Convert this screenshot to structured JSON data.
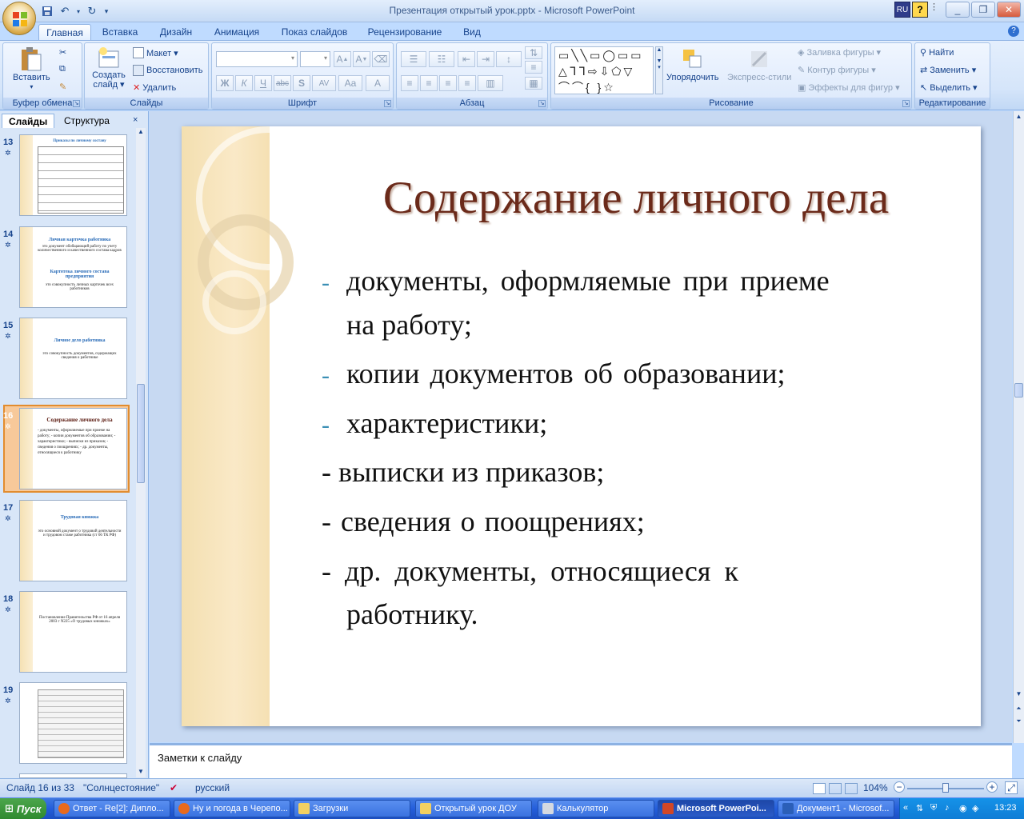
{
  "window": {
    "title": "Презентация открытый урок.pptx - Microsoft PowerPoint",
    "lang": "RU",
    "help": "?"
  },
  "tabs": [
    "Главная",
    "Вставка",
    "Дизайн",
    "Анимация",
    "Показ слайдов",
    "Рецензирование",
    "Вид"
  ],
  "ribbon": {
    "clipboard": {
      "label": "Буфер обмена",
      "paste": "Вставить"
    },
    "slides": {
      "label": "Слайды",
      "new_slide": "Создать слайд ▾",
      "layout": "Макет ▾",
      "reset": "Восстановить",
      "delete": "Удалить"
    },
    "font": {
      "label": "Шрифт",
      "buttons": [
        "Ж",
        "К",
        "Ч",
        "abc",
        "S",
        "AV",
        "Aa",
        "A"
      ]
    },
    "paragraph": {
      "label": "Абзац"
    },
    "drawing": {
      "label": "Рисование",
      "arrange": "Упорядочить",
      "quick_styles": "Экспресс-стили",
      "fill": "Заливка фигуры ▾",
      "outline": "Контур фигуры ▾",
      "effects": "Эффекты для фигур ▾"
    },
    "editing": {
      "label": "Редактирование",
      "find": "Найти",
      "replace": "Заменить ▾",
      "select": "Выделить ▾"
    }
  },
  "left_pane": {
    "tabs": [
      "Слайды",
      "Структура"
    ],
    "close": "×",
    "thumbnails": [
      {
        "num": "13",
        "title": "Приказы по личному составу",
        "body": ""
      },
      {
        "num": "14",
        "title": "Личная карточка работника",
        "body": "это документ обобщающий работу по учету количественного и качественного состава кадров",
        "title2": "Картотека личного состава предприятия",
        "body2": "это совокупность личных карточек всех работников"
      },
      {
        "num": "15",
        "title": "Личное дело работника",
        "body": "это совокупность документов, содержащих сведения о работнике"
      },
      {
        "num": "16",
        "title": "Содержание личного дела",
        "body": "- документы, оформляемые при приеме на работу; - копии документов об образовании; - характеристики; - выписки из приказов; - сведения о поощрениях; - др. документы, относящиеся к работнику"
      },
      {
        "num": "17",
        "title": "Трудовая книжка",
        "body": "это основной документ о трудовой деятельности и трудовом стаже работника (ст 66 ТК РФ)"
      },
      {
        "num": "18",
        "title": "",
        "body": "Постановление Правительства РФ от 16 апреля 2003 г N225 «О трудовых книжках»"
      },
      {
        "num": "19",
        "title": "",
        "body": ""
      }
    ]
  },
  "slide": {
    "title": "Содержание личного дела",
    "bullets": [
      {
        "marker": "-",
        "text": "документы, оформляемые при приеме",
        "cont": "на работу;"
      },
      {
        "marker": "-",
        "text": "копии документов об образовании;"
      },
      {
        "marker": "-",
        "text": "характеристики;"
      },
      {
        "marker": "-",
        "text": " выписки из приказов;"
      },
      {
        "marker": "-",
        "text": " сведения о поощрениях;"
      },
      {
        "marker": "-",
        "text": " др. документы, относящиеся к",
        "cont": "работнику."
      }
    ]
  },
  "notes": {
    "placeholder": "Заметки к слайду"
  },
  "status": {
    "slide": "Слайд 16 из 33",
    "theme": "\"Солнцестояние\"",
    "language": "русский",
    "zoom": "104%"
  },
  "taskbar": {
    "start": "Пуск",
    "tasks": [
      "Ответ - Re[2]: Дипло...",
      "Ну и погода в Черепо...",
      "Загрузки",
      "Открытый урок ДОУ",
      "Калькулятор",
      "Microsoft PowerPoi...",
      "Документ1 - Microsof..."
    ],
    "time": "13:23"
  },
  "colors": {
    "accent": "#15428b",
    "title": "#6b2a1a",
    "bullet_dash": "#3b8fb5",
    "selection": "#e28c2f"
  }
}
